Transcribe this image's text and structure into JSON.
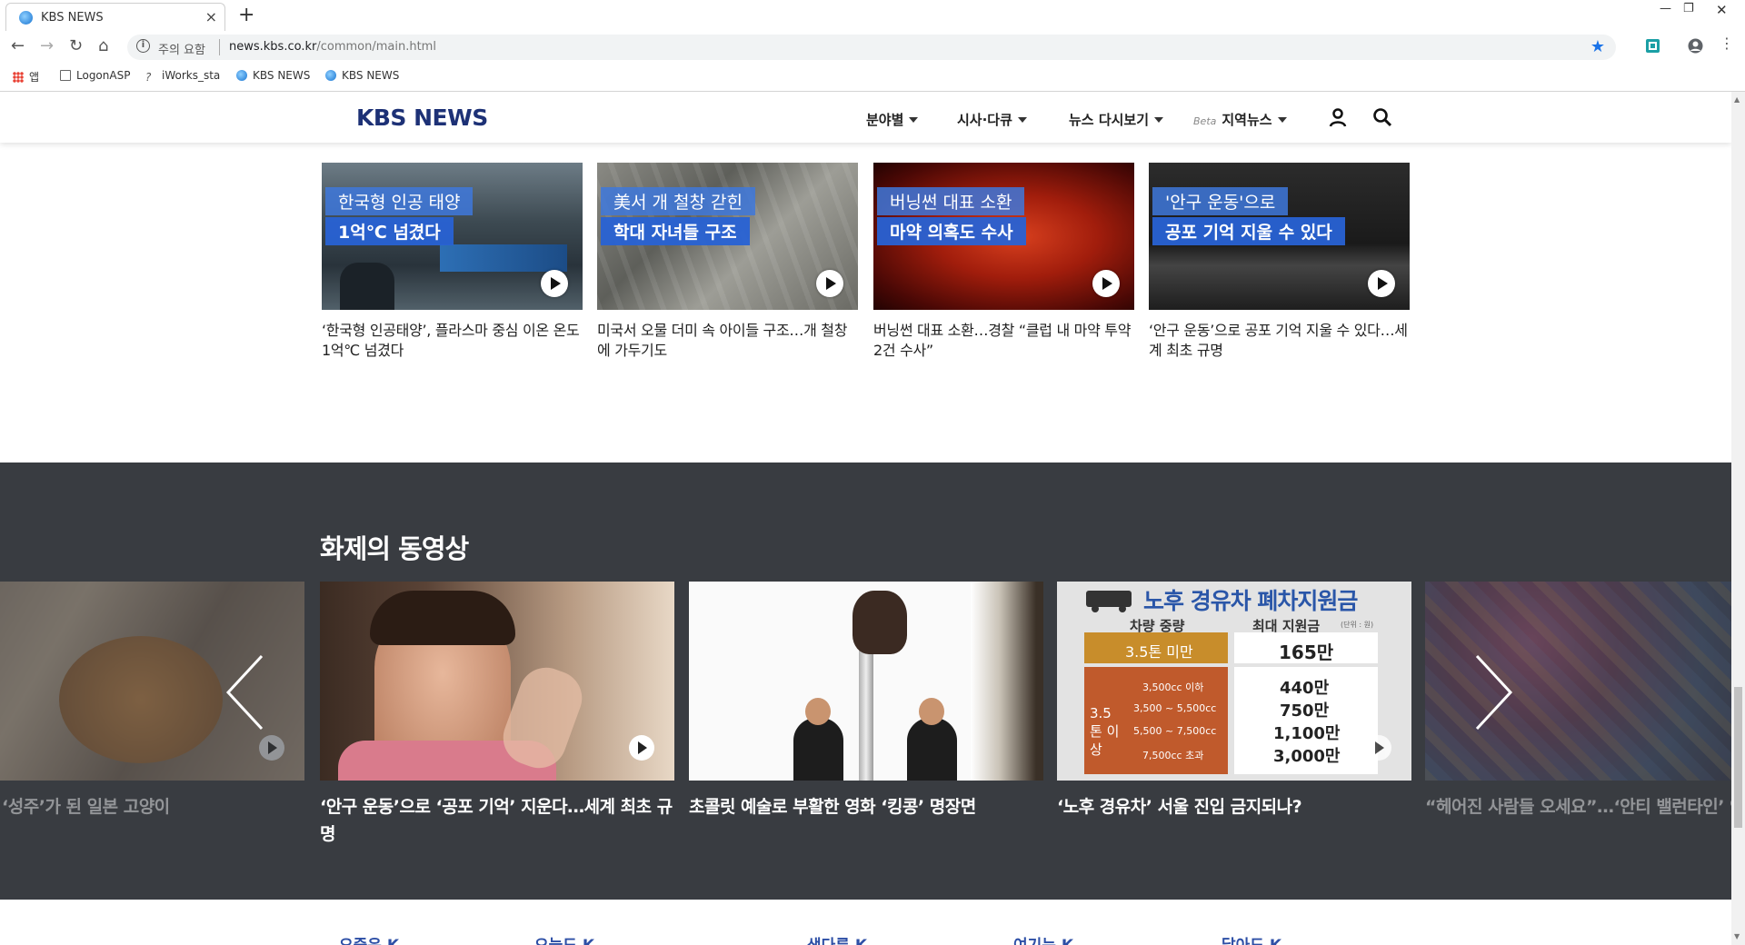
{
  "browser": {
    "tab_title": "KBS NEWS",
    "security_warning": "주의 요함",
    "url_host": "news.kbs.co.kr",
    "url_path": "/common/main.html",
    "bookmarks": [
      {
        "icon": "apps-icon",
        "label": "앱"
      },
      {
        "icon": "page-icon",
        "label": "LogonASP"
      },
      {
        "icon": "iworks-icon",
        "label": "iWorks_sta"
      },
      {
        "icon": "kbs-favicon",
        "label": "KBS NEWS"
      },
      {
        "icon": "kbs-favicon",
        "label": "KBS NEWS"
      }
    ]
  },
  "header": {
    "logo": "KBS NEWS",
    "menu": [
      {
        "label": "분야별"
      },
      {
        "label": "시사·다큐"
      },
      {
        "label": "뉴스 다시보기"
      },
      {
        "label": "지역뉴스",
        "badge": "Beta"
      }
    ]
  },
  "top_news": [
    {
      "caption_1": "한국형 인공 태양",
      "caption_2": "1억℃ 넘겼다",
      "headline": "‘한국형 인공태양’, 플라스마 중심 이온 온도 1억℃ 넘겼다"
    },
    {
      "caption_1": "美서 개 철창 갇힌",
      "caption_2": "학대 자녀들 구조",
      "headline": "미국서 오물 더미 속 아이들 구조…개 철창에 가두기도"
    },
    {
      "caption_1": "버닝썬 대표 소환",
      "caption_2": "마약 의혹도 수사",
      "headline": "버닝썬 대표 소환…경찰 “클럽 내 마약 투약 2건 수사”"
    },
    {
      "caption_1": "'안구 운동'으로",
      "caption_2": "공포 기억 지울 수 있다",
      "headline": "‘안구 운동’으로 공포 기억 지울 수 있다…세계 최초 규명"
    }
  ],
  "videos": {
    "section_title": "화제의 동영상",
    "items": [
      {
        "title": "이에서 ‘성주’가 된 일본 고양이"
      },
      {
        "title": "‘안구 운동’으로 ‘공포 기억’ 지운다…세계 최초 규명"
      },
      {
        "title": "초콜릿 예술로 부활한 영화 ‘킹콩’ 명장면"
      },
      {
        "title": "‘노후 경유차’ 서울 진입 금지되나?"
      },
      {
        "title": "“헤어진 사람들 오세요”…‘안티 밸런타인’ 인기"
      }
    ],
    "infographic": {
      "title": "노후 경유차 폐차지원금",
      "col_1": "차량 중량",
      "col_2": "최대 지원금",
      "unit": "(단위 : 원)",
      "row_top_label": "3.5톤 미만",
      "row_top_value": "165만",
      "group_label": "3.5톤 이상",
      "sub_rows": [
        {
          "label": "3,500cc 이하",
          "value": "440만"
        },
        {
          "label": "3,500 ~ 5,500cc",
          "value": "750만"
        },
        {
          "label": "5,500 ~ 7,500cc",
          "value": "1,100만"
        },
        {
          "label": "7,500cc 초과",
          "value": "3,000만"
        }
      ]
    }
  },
  "footer_links": [
    "요즘은 K",
    "오늘도 K",
    "색다른 K",
    "여기는 K",
    "달아도 K"
  ]
}
